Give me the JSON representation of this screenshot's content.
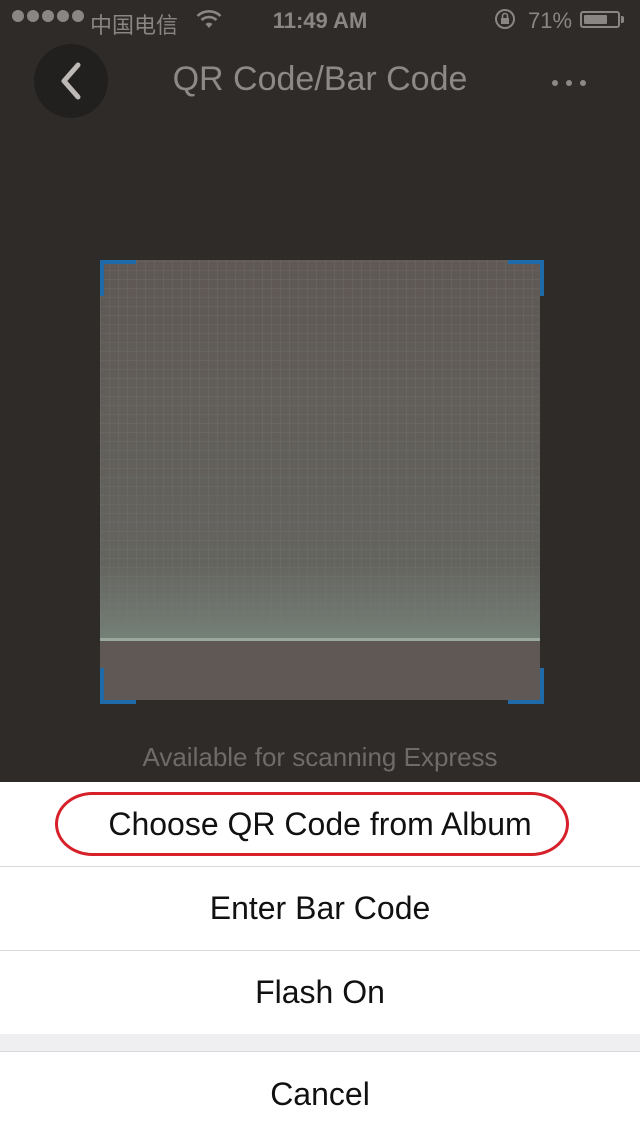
{
  "status_bar": {
    "carrier": "中国电信",
    "time": "11:49 AM",
    "battery_percent_text": "71%",
    "battery_level": 0.71,
    "signal_dots": 5
  },
  "nav": {
    "title": "QR Code/Bar Code",
    "back_icon": "chevron-left-icon",
    "more_icon": "more-horizontal-icon"
  },
  "scanner": {
    "hint": "Available for scanning Express"
  },
  "action_sheet": {
    "choose_album": "Choose QR Code from Album",
    "enter_barcode": "Enter Bar Code",
    "flash_on": "Flash On",
    "cancel": "Cancel"
  },
  "colors": {
    "corner_accent": "#1f6aa8",
    "highlight_annotation": "#d6202a"
  }
}
